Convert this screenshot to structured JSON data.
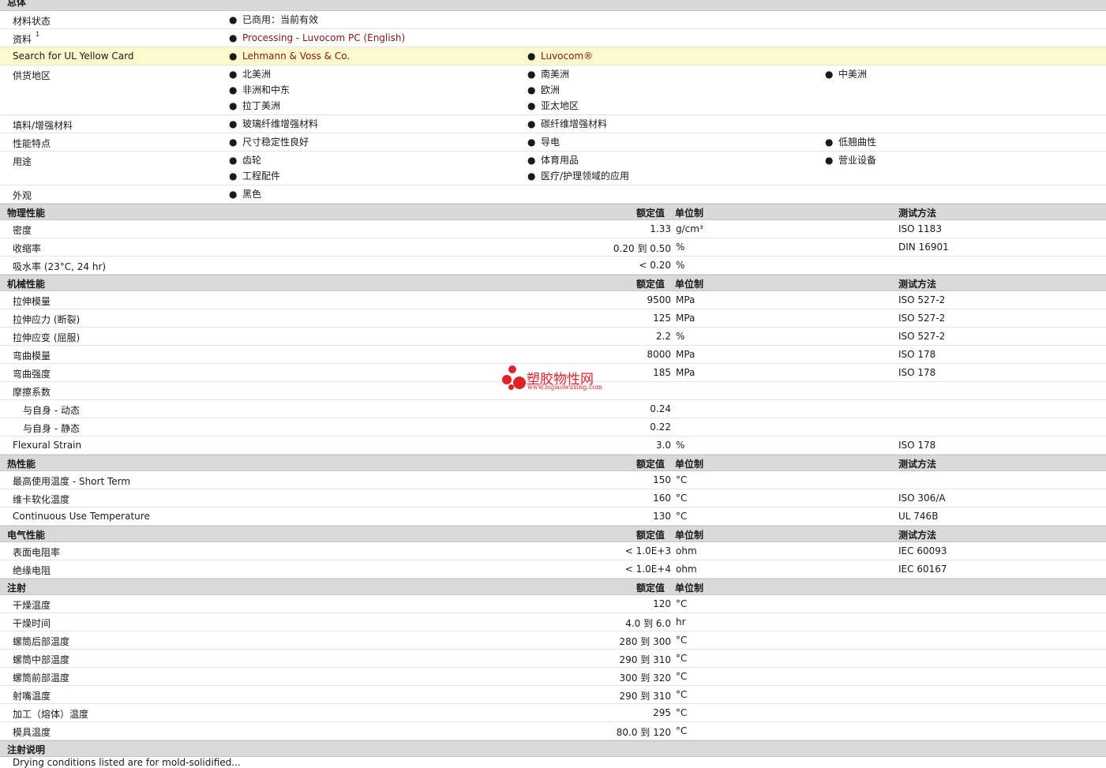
{
  "general": {
    "title": "总体",
    "rows": [
      {
        "label": "材料状态",
        "cols": [
          [
            {
              "text": "已商用：当前有效"
            }
          ]
        ]
      },
      {
        "label": "资料",
        "sup": "1",
        "cols": [
          [
            {
              "text": "Processing - Luvocom PC (English)",
              "link": true
            }
          ]
        ]
      },
      {
        "label": "Search for UL Yellow Card",
        "highlight": true,
        "cols": [
          [
            {
              "text": "Lehmann & Voss & Co.",
              "link": true
            }
          ],
          [
            {
              "text": "Luvocom®",
              "link": true
            }
          ]
        ]
      },
      {
        "label": "供货地区",
        "cols": [
          [
            {
              "text": "北美洲"
            },
            {
              "text": "非洲和中东"
            },
            {
              "text": "拉丁美洲"
            }
          ],
          [
            {
              "text": "南美洲"
            },
            {
              "text": "欧洲"
            },
            {
              "text": "亚太地区"
            }
          ],
          [
            {
              "text": "中美洲"
            }
          ]
        ]
      },
      {
        "label": "填料/增强材料",
        "cols": [
          [
            {
              "text": "玻璃纤维增强材料"
            }
          ],
          [
            {
              "text": "碳纤维增强材料"
            }
          ]
        ]
      },
      {
        "label": "性能特点",
        "cols": [
          [
            {
              "text": "尺寸稳定性良好"
            }
          ],
          [
            {
              "text": "导电"
            }
          ],
          [
            {
              "text": "低翘曲性"
            }
          ]
        ]
      },
      {
        "label": "用途",
        "cols": [
          [
            {
              "text": "齿轮"
            },
            {
              "text": "工程配件"
            }
          ],
          [
            {
              "text": "体育用品"
            },
            {
              "text": "医疗/护理领域的应用"
            }
          ],
          [
            {
              "text": "营业设备"
            }
          ]
        ]
      },
      {
        "label": "外观",
        "cols": [
          [
            {
              "text": "黑色"
            }
          ]
        ]
      }
    ]
  },
  "sections": [
    {
      "title": "物理性能",
      "h_value": "额定值",
      "h_unit": "单位制",
      "h_method": "测试方法",
      "rows": [
        {
          "label": "密度",
          "value": "1.33",
          "unit": "g/cm³",
          "method": "ISO 1183"
        },
        {
          "label": "收缩率",
          "value": "0.20 到  0.50",
          "unit": "%",
          "method": "DIN 16901"
        },
        {
          "label": "吸水率  (23°C, 24 hr)",
          "value": "< 0.20",
          "unit": "%",
          "method": ""
        }
      ]
    },
    {
      "title": "机械性能",
      "h_value": "额定值",
      "h_unit": "单位制",
      "h_method": "测试方法",
      "rows": [
        {
          "label": "拉伸模量",
          "value": "9500",
          "unit": "MPa",
          "method": "ISO 527-2"
        },
        {
          "label": "拉伸应力  (断裂)",
          "value": "125",
          "unit": "MPa",
          "method": "ISO 527-2"
        },
        {
          "label": "拉伸应变  (屈服)",
          "value": "2.2",
          "unit": "%",
          "method": "ISO 527-2"
        },
        {
          "label": "弯曲模量",
          "value": "8000",
          "unit": "MPa",
          "method": "ISO 178"
        },
        {
          "label": "弯曲强度",
          "value": "185",
          "unit": "MPa",
          "method": "ISO 178"
        },
        {
          "label": "摩擦系数",
          "value": "",
          "unit": "",
          "method": ""
        },
        {
          "label": "与自身  - 动态",
          "sub": true,
          "value": "0.24",
          "unit": "",
          "method": ""
        },
        {
          "label": "与自身  - 静态",
          "sub": true,
          "value": "0.22",
          "unit": "",
          "method": ""
        },
        {
          "label": "Flexural Strain",
          "value": "3.0",
          "unit": "%",
          "method": "ISO 178"
        }
      ]
    },
    {
      "title": "热性能",
      "h_value": "额定值",
      "h_unit": "单位制",
      "h_method": "测试方法",
      "rows": [
        {
          "label": "最高使用温度  - Short Term",
          "value": "150",
          "unit": "°C",
          "method": ""
        },
        {
          "label": "维卡软化温度",
          "value": "160",
          "unit": "°C",
          "method": "ISO 306/A"
        },
        {
          "label": "Continuous Use Temperature",
          "value": "130",
          "unit": "°C",
          "method": "UL 746B"
        }
      ]
    },
    {
      "title": "电气性能",
      "h_value": "额定值",
      "h_unit": "单位制",
      "h_method": "测试方法",
      "rows": [
        {
          "label": "表面电阻率",
          "value": "< 1.0E+3",
          "unit": "ohm",
          "method": "IEC 60093"
        },
        {
          "label": "绝缘电阻",
          "value": "< 1.0E+4",
          "unit": "ohm",
          "method": "IEC 60167"
        }
      ]
    },
    {
      "title": "注射",
      "h_value": "额定值",
      "h_unit": "单位制",
      "h_method": "",
      "rows": [
        {
          "label": "干燥温度",
          "value": "120",
          "unit": "°C",
          "method": ""
        },
        {
          "label": "干燥时间",
          "value": "4.0 到  6.0",
          "unit": "hr",
          "method": ""
        },
        {
          "label": "螺筒后部温度",
          "value": "280 到  300",
          "unit": "°C",
          "method": ""
        },
        {
          "label": "螺筒中部温度",
          "value": "290 到  310",
          "unit": "°C",
          "method": ""
        },
        {
          "label": "螺筒前部温度",
          "value": "300 到  320",
          "unit": "°C",
          "method": ""
        },
        {
          "label": "射嘴温度",
          "value": "290 到  310",
          "unit": "°C",
          "method": ""
        },
        {
          "label": "加工（熔体）温度",
          "value": "295",
          "unit": "°C",
          "method": ""
        },
        {
          "label": "模具温度",
          "value": "80.0 到  120",
          "unit": "°C",
          "method": ""
        }
      ]
    },
    {
      "title": "注射说明",
      "h_value": "",
      "h_unit": "",
      "h_method": "",
      "rows": []
    }
  ],
  "footer_cut_text": "Drying conditions listed are for mold-solidified...",
  "watermark": {
    "text": "塑胶物性网",
    "url": "www.sujiaowuxing.com",
    "color": "#e0222a"
  },
  "bullet": "●"
}
